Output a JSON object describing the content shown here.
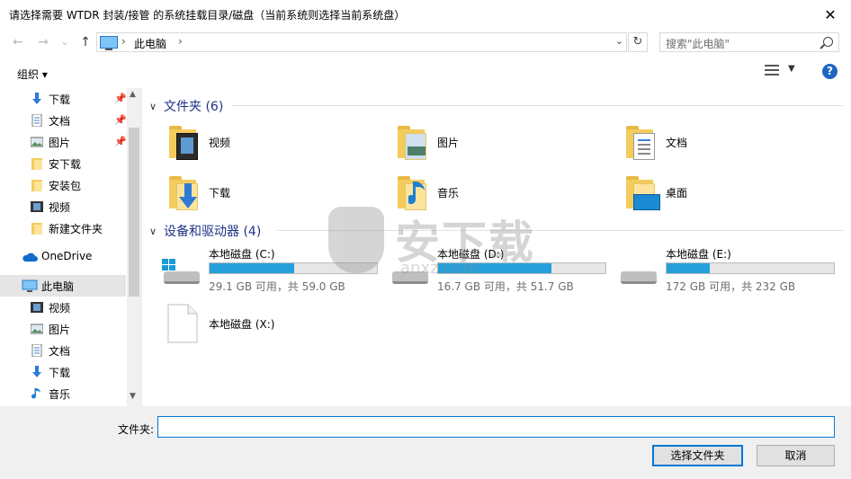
{
  "window": {
    "title": "请选择需要 WTDR 封装/接管 的系统挂载目录/磁盘（当前系统则选择当前系统盘）",
    "close_glyph": "✕"
  },
  "nav": {
    "back": "←",
    "forward": "→",
    "dropdown": "⌄",
    "up": "↑",
    "address": "此电脑",
    "refresh": "↻",
    "search_placeholder": "搜索\"此电脑\""
  },
  "toolbar": {
    "organize": "组织 ▾",
    "help": "?"
  },
  "sidebar": {
    "items": [
      {
        "label": "下载",
        "icon": "download-icon",
        "pinned": true
      },
      {
        "label": "文档",
        "icon": "document-icon",
        "pinned": true
      },
      {
        "label": "图片",
        "icon": "picture-icon",
        "pinned": true
      },
      {
        "label": "安下载",
        "icon": "folder-icon",
        "pinned": false
      },
      {
        "label": "安装包",
        "icon": "folder-icon",
        "pinned": false
      },
      {
        "label": "视频",
        "icon": "video-icon",
        "pinned": false
      },
      {
        "label": "新建文件夹",
        "icon": "folder-icon",
        "pinned": false
      },
      {
        "label": "OneDrive",
        "icon": "cloud-icon",
        "pinned": false
      },
      {
        "label": "此电脑",
        "icon": "computer-icon",
        "pinned": false,
        "selected": true
      },
      {
        "label": "视频",
        "icon": "video-icon",
        "pinned": false
      },
      {
        "label": "图片",
        "icon": "picture-icon",
        "pinned": false
      },
      {
        "label": "文档",
        "icon": "document-icon",
        "pinned": false
      },
      {
        "label": "下载",
        "icon": "download-icon",
        "pinned": false
      },
      {
        "label": "音乐",
        "icon": "music-icon",
        "pinned": false
      }
    ]
  },
  "content": {
    "folders_header": "文件夹 (6)",
    "folders": [
      {
        "label": "视频",
        "icon": "video-folder-icon"
      },
      {
        "label": "图片",
        "icon": "picture-folder-icon"
      },
      {
        "label": "文档",
        "icon": "document-folder-icon"
      },
      {
        "label": "下载",
        "icon": "download-folder-icon"
      },
      {
        "label": "音乐",
        "icon": "music-folder-icon"
      },
      {
        "label": "桌面",
        "icon": "desktop-folder-icon"
      }
    ],
    "drives_header": "设备和驱动器 (4)",
    "drives": [
      {
        "label": "本地磁盘 (C:)",
        "free": "29.1 GB 可用，共 59.0 GB",
        "used_fraction": 0.507,
        "icon": "system-drive-icon"
      },
      {
        "label": "本地磁盘 (D:)",
        "free": "16.7 GB 可用，共 51.7 GB",
        "used_fraction": 0.677,
        "icon": "drive-icon"
      },
      {
        "label": "本地磁盘 (E:)",
        "free": "172 GB 可用，共 232 GB",
        "used_fraction": 0.259,
        "icon": "drive-icon"
      },
      {
        "label": "本地磁盘 (X:)",
        "icon": "blank-drive-icon"
      }
    ]
  },
  "watermark": {
    "text": "安下载",
    "sub": "anxz.com"
  },
  "footer": {
    "filename_label": "文件夹:",
    "filename_value": "",
    "select_button": "选择文件夹",
    "cancel_button": "取消"
  },
  "colors": {
    "accent": "#0078d7",
    "header_text": "#1e3287",
    "drive_fill": "#26a0da",
    "folder": "#f4cc5d"
  }
}
